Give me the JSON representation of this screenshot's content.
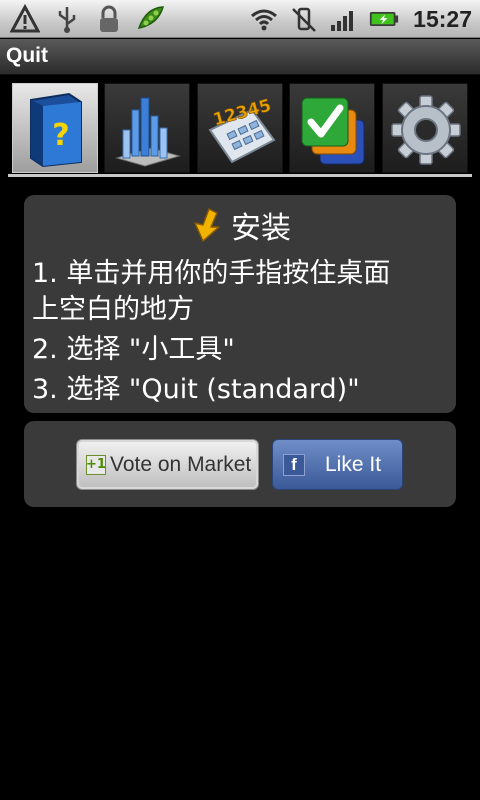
{
  "status_bar": {
    "time": "15:27",
    "icons": [
      "alert-icon",
      "usb-icon",
      "lock-icon",
      "peapod-icon",
      "wifi-icon",
      "vibrate-icon",
      "signal-icon",
      "battery-icon"
    ]
  },
  "app": {
    "title": "Quit"
  },
  "tabs": [
    {
      "icon": "help-book-icon",
      "active": true
    },
    {
      "icon": "bar-chart-icon",
      "active": false
    },
    {
      "icon": "keypad-icon",
      "active": false
    },
    {
      "icon": "checkmark-cards-icon",
      "active": false
    },
    {
      "icon": "settings-gear-icon",
      "active": false
    }
  ],
  "install": {
    "heading": "安装",
    "heading_icon": "down-arrow-icon",
    "steps": {
      "line1": "1. 单击并用你的手指按住桌面",
      "line2": "上空白的地方",
      "line3": "2. 选择 \"小工具\"",
      "line4": "3. 选择 \"Quit (standard)\""
    }
  },
  "buttons": {
    "vote_badge": "+1",
    "vote_label": "Vote on Market",
    "fb_badge": "f",
    "like_label": "Like It"
  },
  "colors": {
    "panel": "#3a3a3a",
    "facebook": "#3b5998",
    "background": "#000000"
  }
}
